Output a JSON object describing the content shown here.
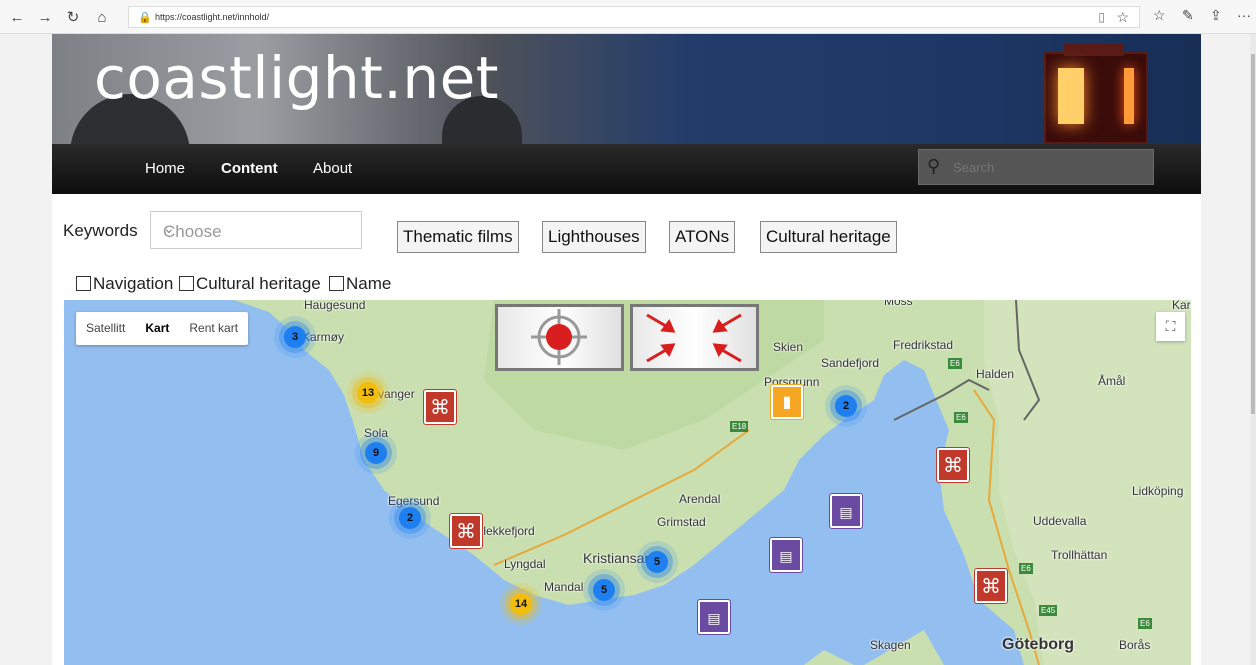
{
  "browser": {
    "url": "https://coastlight.net/innhold/",
    "back_icon": "←",
    "forward_icon": "→",
    "refresh_icon": "↻",
    "home_icon": "⌂",
    "more_icon": "···"
  },
  "site": {
    "title": "coastlight.net",
    "nav": [
      "Home",
      "Content",
      "About"
    ],
    "active_nav": "Content",
    "search_placeholder": "Search"
  },
  "filters": {
    "keywords_label": "Keywords",
    "keywords_value": "Choose",
    "buttons": [
      "Thematic films",
      "Lighthouses",
      "ATONs",
      "Cultural heritage"
    ],
    "checkboxes": [
      "Navigation",
      "Cultural heritage",
      "Name"
    ]
  },
  "map": {
    "map_types": [
      "Satellitt",
      "Kart",
      "Rent kart"
    ],
    "active_type": "Kart",
    "clusters": [
      {
        "count": "3",
        "color": "blue"
      },
      {
        "count": "13",
        "color": "yellow"
      },
      {
        "count": "9",
        "color": "blue"
      },
      {
        "count": "2",
        "color": "blue"
      },
      {
        "count": "2",
        "color": "blue"
      },
      {
        "count": "5",
        "color": "blue"
      },
      {
        "count": "5",
        "color": "blue"
      },
      {
        "count": "14",
        "color": "yellow"
      }
    ],
    "place_labels": [
      "Haugesund",
      "Karmøy",
      "Stavanger",
      "Sola",
      "Egersund",
      "Flekkefjord",
      "Lyngdal",
      "Mandal",
      "Kristiansand",
      "Grimstad",
      "Arendal",
      "Skien",
      "Porsgrunn",
      "Sandefjord",
      "Fredrikstad",
      "Halden",
      "Moss",
      "Åmål",
      "Lidköping",
      "Uddevalla",
      "Trollhättan",
      "Skagen",
      "Göteborg",
      "Borås",
      "Karlstad"
    ],
    "road_labels": [
      "E18",
      "E6",
      "E6",
      "E6",
      "E45",
      "E6"
    ]
  }
}
